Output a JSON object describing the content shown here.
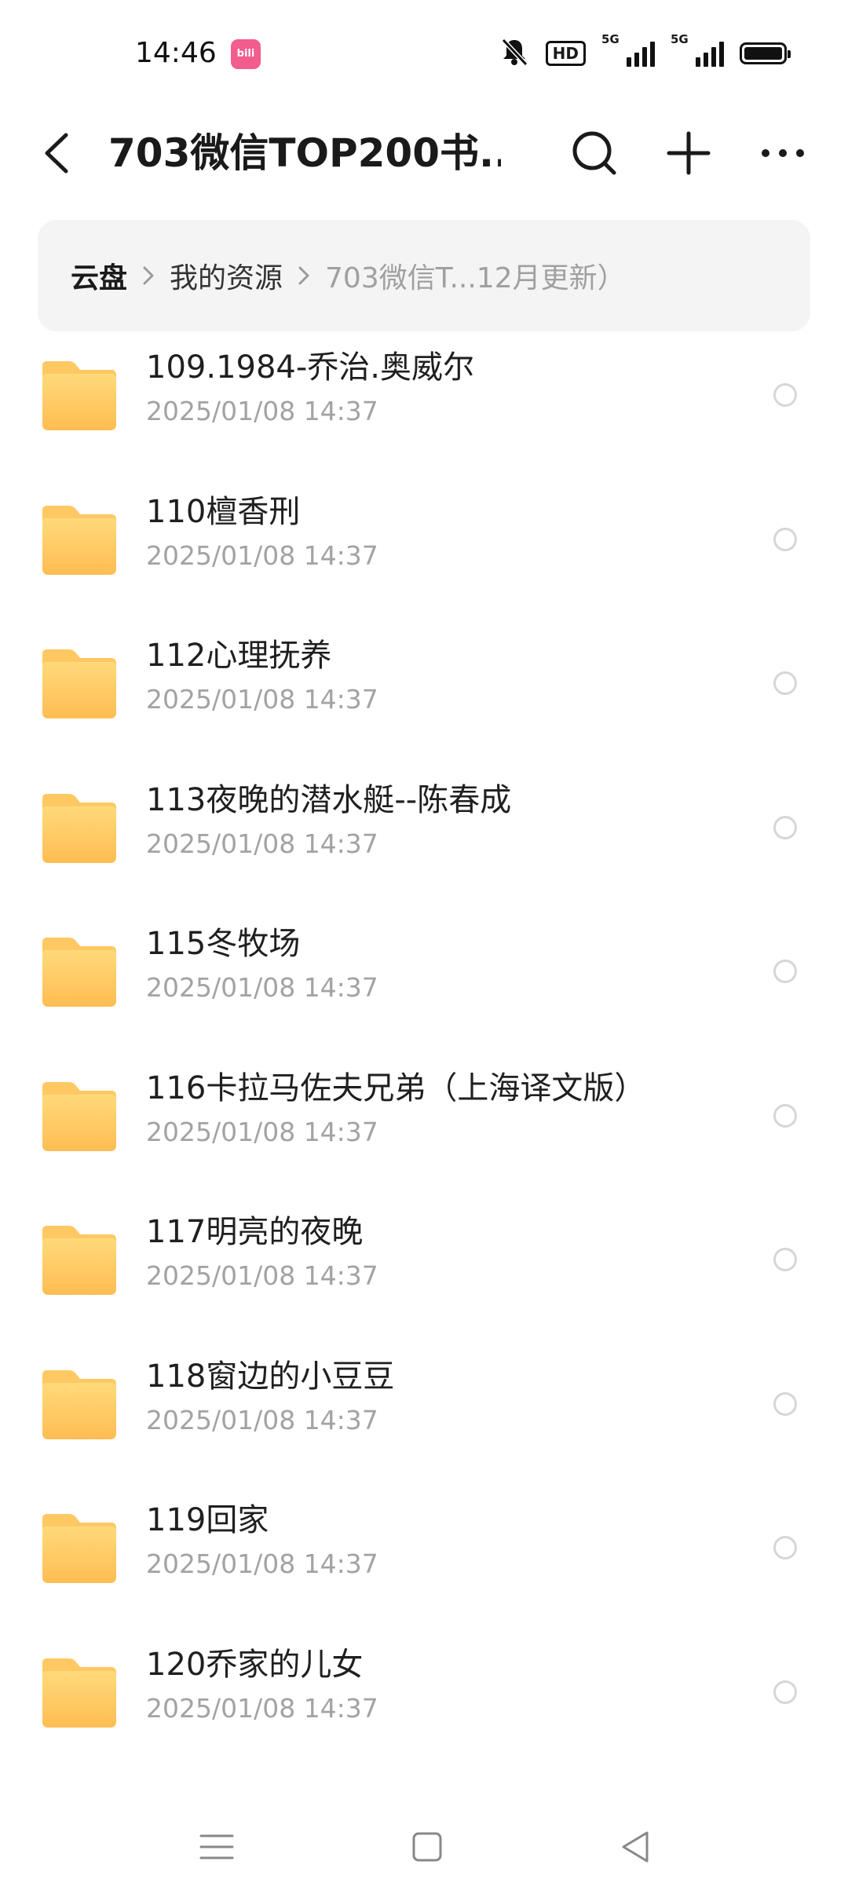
{
  "status_bar": {
    "time": "14:46",
    "app_badge": "bili",
    "hd_label": "HD",
    "network_1": "5G",
    "network_2": "5G"
  },
  "header": {
    "title": "703微信TOP200书..."
  },
  "breadcrumb": {
    "root": "云盘",
    "mid": "我的资源",
    "current": "703微信T...12月更新）"
  },
  "files": [
    {
      "name": "109.1984-乔治.奥威尔",
      "date": "2025/01/08 14:37"
    },
    {
      "name": "110檀香刑",
      "date": "2025/01/08 14:37"
    },
    {
      "name": "112心理抚养",
      "date": "2025/01/08 14:37"
    },
    {
      "name": "113夜晚的潜水艇--陈春成",
      "date": "2025/01/08 14:37"
    },
    {
      "name": "115冬牧场",
      "date": "2025/01/08 14:37"
    },
    {
      "name": "116卡拉马佐夫兄弟（上海译文版）",
      "date": "2025/01/08 14:37"
    },
    {
      "name": "117明亮的夜晚",
      "date": "2025/01/08 14:37"
    },
    {
      "name": "118窗边的小豆豆",
      "date": "2025/01/08 14:37"
    },
    {
      "name": "119回家",
      "date": "2025/01/08 14:37"
    },
    {
      "name": "120乔家的儿女",
      "date": "2025/01/08 14:37"
    }
  ],
  "colors": {
    "folder_top": "#ffd97a",
    "folder_bottom": "#ffbd52",
    "badge": "#f25d8e"
  }
}
